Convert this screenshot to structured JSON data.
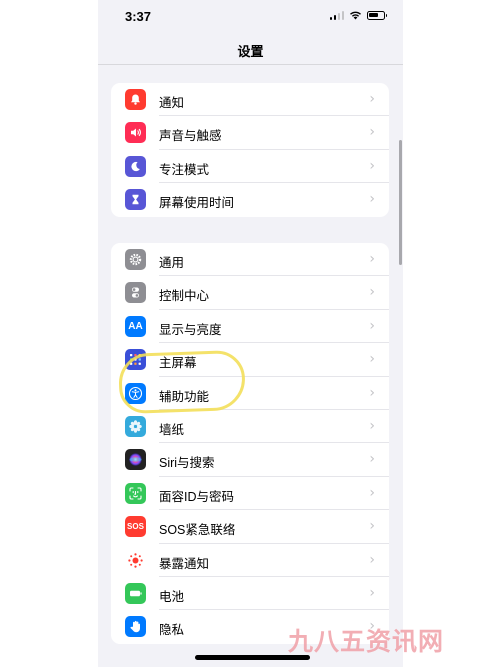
{
  "status_bar": {
    "time": "3:37"
  },
  "nav": {
    "title": "设置"
  },
  "group1": [
    {
      "label": "通知",
      "icon": "bell-icon",
      "color": "#ff3b30"
    },
    {
      "label": "声音与触感",
      "icon": "speaker-icon",
      "color": "#ff2d55"
    },
    {
      "label": "专注模式",
      "icon": "moon-icon",
      "color": "#5856d6"
    },
    {
      "label": "屏幕使用时间",
      "icon": "hourglass-icon",
      "color": "#5856d6"
    }
  ],
  "group2": [
    {
      "label": "通用",
      "icon": "gear-icon",
      "color": "#8e8e93"
    },
    {
      "label": "控制中心",
      "icon": "toggles-icon",
      "color": "#8e8e93"
    },
    {
      "label": "显示与亮度",
      "icon": "text-size-icon",
      "color": "#007aff",
      "glyph": "AA"
    },
    {
      "label": "主屏幕",
      "icon": "home-grid-icon",
      "color": "#3a4fd8"
    },
    {
      "label": "辅助功能",
      "icon": "accessibility-icon",
      "color": "#007aff"
    },
    {
      "label": "墙纸",
      "icon": "flower-icon",
      "color": "#34aadc"
    },
    {
      "label": "Siri与搜索",
      "icon": "siri-icon",
      "color": "#222222"
    },
    {
      "label": "面容ID与密码",
      "icon": "face-id-icon",
      "color": "#34c759"
    },
    {
      "label": "SOS紧急联络",
      "icon": "sos-icon",
      "color": "#ff3b30",
      "glyph": "SOS"
    },
    {
      "label": "暴露通知",
      "icon": "exposure-icon",
      "color": "#ffffff"
    },
    {
      "label": "电池",
      "icon": "battery-icon",
      "color": "#34c759"
    },
    {
      "label": "隐私",
      "icon": "hand-icon",
      "color": "#007aff"
    }
  ],
  "watermark": "九八五资讯网"
}
